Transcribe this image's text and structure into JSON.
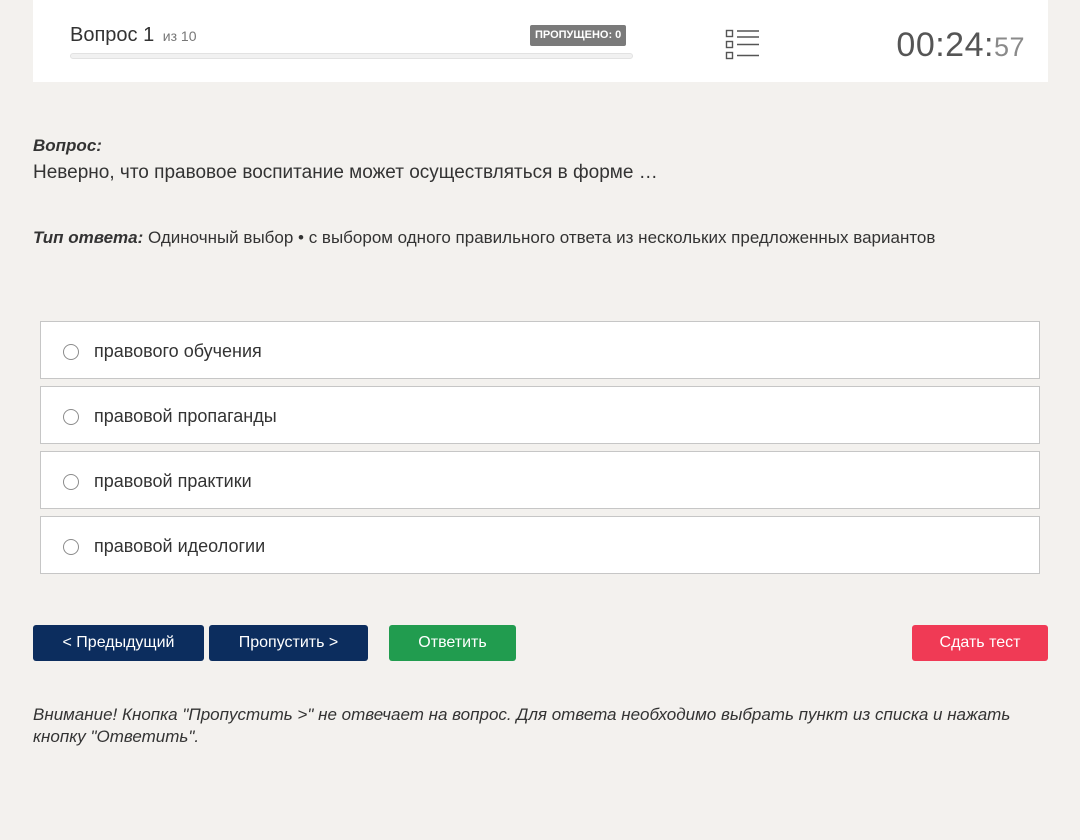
{
  "header": {
    "question_word": "Вопрос",
    "question_number": "1",
    "of_total": "из 10",
    "skipped_badge": "ПРОПУЩЕНО: 0",
    "progress_fraction": 0,
    "timer": {
      "main": "00:24:",
      "seconds": "57"
    },
    "list_icon": "question-list-icon"
  },
  "question": {
    "label": "Вопрос:",
    "text": "Неверно, что правовое воспитание может осуществляться в форме …"
  },
  "answer_type": {
    "label": "Тип ответа:",
    "value": " Одиночный выбор • с выбором одного правильного ответа из нескольких предложенных вариантов"
  },
  "options": [
    {
      "label": "правового обучения",
      "selected": false
    },
    {
      "label": "правовой пропаганды",
      "selected": false
    },
    {
      "label": "правовой практики",
      "selected": false
    },
    {
      "label": "правовой идеологии",
      "selected": false
    }
  ],
  "buttons": {
    "prev": "< Предыдущий",
    "skip": "Пропустить >",
    "answer": "Ответить",
    "finish": "Сдать тест"
  },
  "colors": {
    "page_bg": "#f3f1ee",
    "nav_button": "#0c2d5e",
    "answer_button": "#219c4f",
    "finish_button": "#f03a55",
    "badge": "#7a7a7a"
  },
  "notice": "Внимание! Кнопка \"Пропустить >\" не отвечает на вопрос. Для ответа необходимо выбрать пункт из списка и нажать кнопку \"Ответить\"."
}
